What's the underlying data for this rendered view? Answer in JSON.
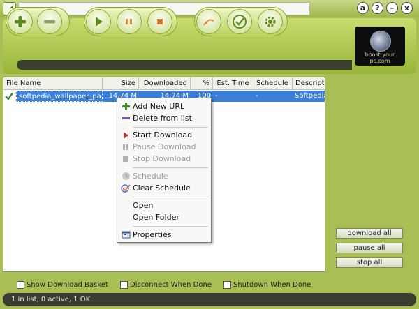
{
  "window": {
    "controls": {
      "about": "a",
      "help": "?",
      "minimize": "–",
      "close": "x"
    }
  },
  "logo": {
    "text": "boost your pc.com"
  },
  "table": {
    "columns": [
      "File Name",
      "Size",
      "Downloaded",
      "%",
      "Est. Time",
      "Schedule",
      "Description"
    ],
    "rows": [
      {
        "file_name": "softpedia_wallpaper_pa...",
        "size": "14.74 M",
        "downloaded": "14.74 M",
        "percent": "100",
        "est_time": "-",
        "schedule": "-",
        "description": "Softpedia"
      }
    ]
  },
  "context_menu": {
    "items": [
      {
        "label": "Add New URL",
        "icon": "add-url-icon",
        "enabled": true
      },
      {
        "label": "Delete from list",
        "icon": "delete-icon",
        "enabled": true
      },
      {
        "label": "Start Download",
        "icon": "start-icon",
        "enabled": true
      },
      {
        "label": "Pause Download",
        "icon": "pause-icon",
        "enabled": false
      },
      {
        "label": "Stop Download",
        "icon": "stop-icon",
        "enabled": false
      },
      {
        "label": "Schedule",
        "icon": "schedule-icon",
        "enabled": false
      },
      {
        "label": "Clear Schedule",
        "icon": "clear-schedule-icon",
        "enabled": true
      },
      {
        "label": "Open",
        "icon": "",
        "enabled": true
      },
      {
        "label": "Open Folder",
        "icon": "",
        "enabled": true
      },
      {
        "label": "Properties",
        "icon": "properties-icon",
        "enabled": true
      }
    ]
  },
  "side_buttons": {
    "download_all": "download all",
    "pause_all": "pause all",
    "stop_all": "stop all"
  },
  "options": {
    "show_basket": "Show Download Basket",
    "disconnect": "Disconnect When Done",
    "shutdown": "Shutdown When Done"
  },
  "status": {
    "text": "1 in list, 0 active, 1 OK"
  },
  "colors": {
    "accent_green": "#a9bf55",
    "selection_blue": "#3b7fd6",
    "dark_bar": "#3c3f2f"
  }
}
